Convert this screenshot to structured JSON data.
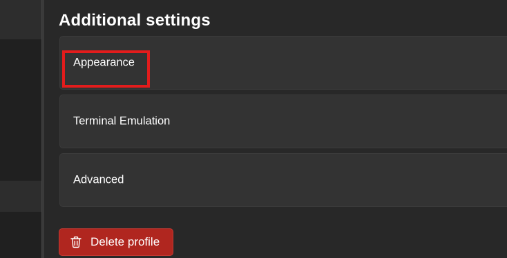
{
  "section": {
    "title": "Additional settings"
  },
  "cards": [
    {
      "label": "Appearance"
    },
    {
      "label": "Terminal Emulation"
    },
    {
      "label": "Advanced"
    }
  ],
  "delete_button": {
    "label": "Delete profile",
    "icon": "trash-icon"
  },
  "colors": {
    "background": "#282828",
    "card": "#333333",
    "danger": "#b0261f",
    "highlight": "#e31c1c"
  }
}
